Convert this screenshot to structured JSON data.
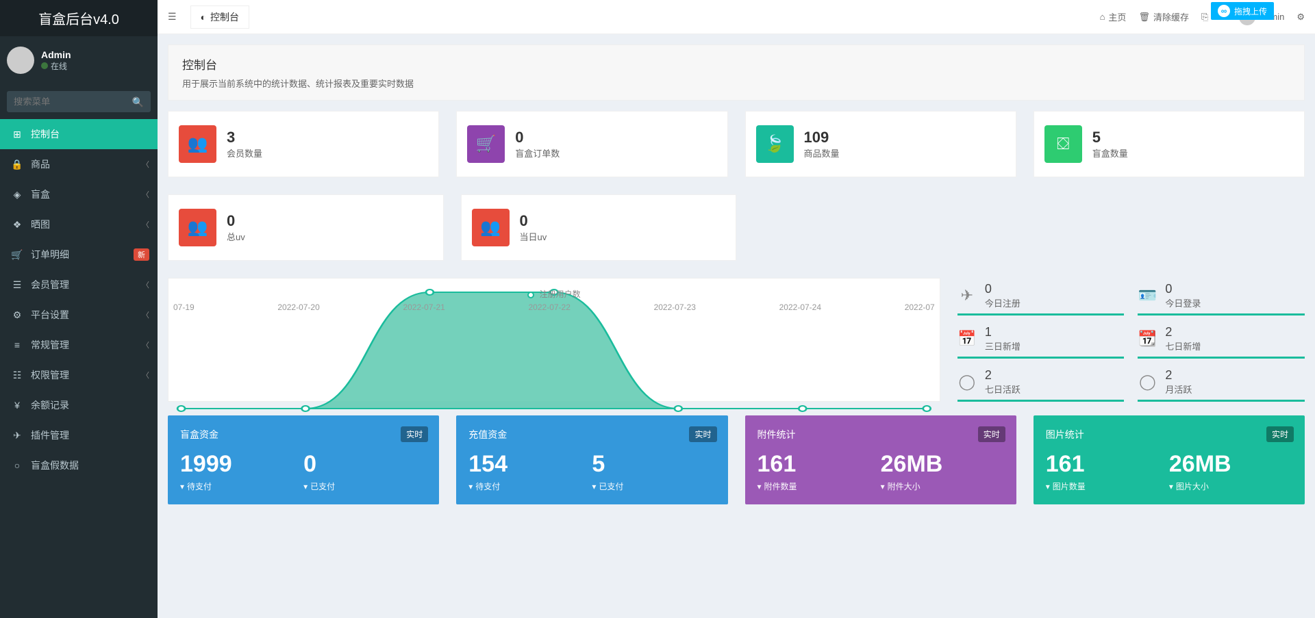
{
  "brand": "盲盒后台v4.0",
  "user": {
    "name": "Admin",
    "status": "在线"
  },
  "search": {
    "placeholder": "搜索菜单"
  },
  "menu": [
    {
      "label": "控制台",
      "icon": "⊞",
      "active": true
    },
    {
      "label": "商品",
      "icon": "🔒",
      "chev": true
    },
    {
      "label": "盲盒",
      "icon": "◈",
      "chev": true
    },
    {
      "label": "晒图",
      "icon": "❖",
      "chev": true
    },
    {
      "label": "订单明细",
      "icon": "🛒",
      "badge": "新"
    },
    {
      "label": "会员管理",
      "icon": "☰",
      "chev": true
    },
    {
      "label": "平台设置",
      "icon": "⚙",
      "chev": true
    },
    {
      "label": "常规管理",
      "icon": "≡",
      "chev": true
    },
    {
      "label": "权限管理",
      "icon": "☷",
      "chev": true
    },
    {
      "label": "余额记录",
      "icon": "¥"
    },
    {
      "label": "插件管理",
      "icon": "✈"
    },
    {
      "label": "盲盒假数据",
      "icon": "○"
    }
  ],
  "topbar": {
    "tab": "控制台",
    "home": "主页",
    "clear": "清除缓存",
    "admin": "Admin",
    "upload": "拖拽上传"
  },
  "header": {
    "title": "控制台",
    "subtitle": "用于展示当前系统中的统计数据、统计报表及重要实时数据"
  },
  "stats1": [
    {
      "num": "3",
      "label": "会员数量",
      "cls": "bg-red",
      "icon": "users"
    },
    {
      "num": "0",
      "label": "盲盒订单数",
      "cls": "bg-purple",
      "icon": "cart"
    },
    {
      "num": "109",
      "label": "商品数量",
      "cls": "bg-teal",
      "icon": "leaf"
    },
    {
      "num": "5",
      "label": "盲盒数量",
      "cls": "bg-green",
      "icon": "box"
    }
  ],
  "stats2": [
    {
      "num": "0",
      "label": "总uv",
      "cls": "bg-red",
      "icon": "users"
    },
    {
      "num": "0",
      "label": "当日uv",
      "cls": "bg-red",
      "icon": "users"
    }
  ],
  "side_stats": [
    [
      {
        "n": "0",
        "l": "今日注册",
        "icon": "✈"
      },
      {
        "n": "0",
        "l": "今日登录",
        "icon": "🪪"
      }
    ],
    [
      {
        "n": "1",
        "l": "三日新增",
        "icon": "📅"
      },
      {
        "n": "2",
        "l": "七日新增",
        "icon": "📆"
      }
    ],
    [
      {
        "n": "2",
        "l": "七日活跃",
        "icon": "◯"
      },
      {
        "n": "2",
        "l": "月活跃",
        "icon": "◯"
      }
    ]
  ],
  "chart_legend": "注册用户数",
  "chart_data": {
    "type": "area",
    "title": "",
    "xlabel": "",
    "ylabel": "",
    "x": [
      "07-19",
      "2022-07-20",
      "2022-07-21",
      "2022-07-22",
      "2022-07-23",
      "2022-07-24",
      "2022-07"
    ],
    "series": [
      {
        "name": "注册用户数",
        "values": [
          0,
          0,
          2,
          2,
          0,
          0,
          0
        ]
      }
    ],
    "ylim": [
      0,
      2
    ]
  },
  "cards": [
    {
      "cls": "cc-blue",
      "title": "盲盒资金",
      "badge": "实时",
      "cols": [
        {
          "num": "1999",
          "sub": "待支付"
        },
        {
          "num": "0",
          "sub": "已支付"
        }
      ]
    },
    {
      "cls": "cc-blue",
      "title": "充值资金",
      "badge": "实时",
      "cols": [
        {
          "num": "154",
          "sub": "待支付"
        },
        {
          "num": "5",
          "sub": "已支付"
        }
      ]
    },
    {
      "cls": "cc-purple",
      "title": "附件统计",
      "badge": "实时",
      "cols": [
        {
          "num": "161",
          "sub": "附件数量"
        },
        {
          "num": "26MB",
          "sub": "附件大小"
        }
      ]
    },
    {
      "cls": "cc-teal",
      "title": "图片统计",
      "badge": "实时",
      "cols": [
        {
          "num": "161",
          "sub": "图片数量"
        },
        {
          "num": "26MB",
          "sub": "图片大小"
        }
      ]
    }
  ]
}
